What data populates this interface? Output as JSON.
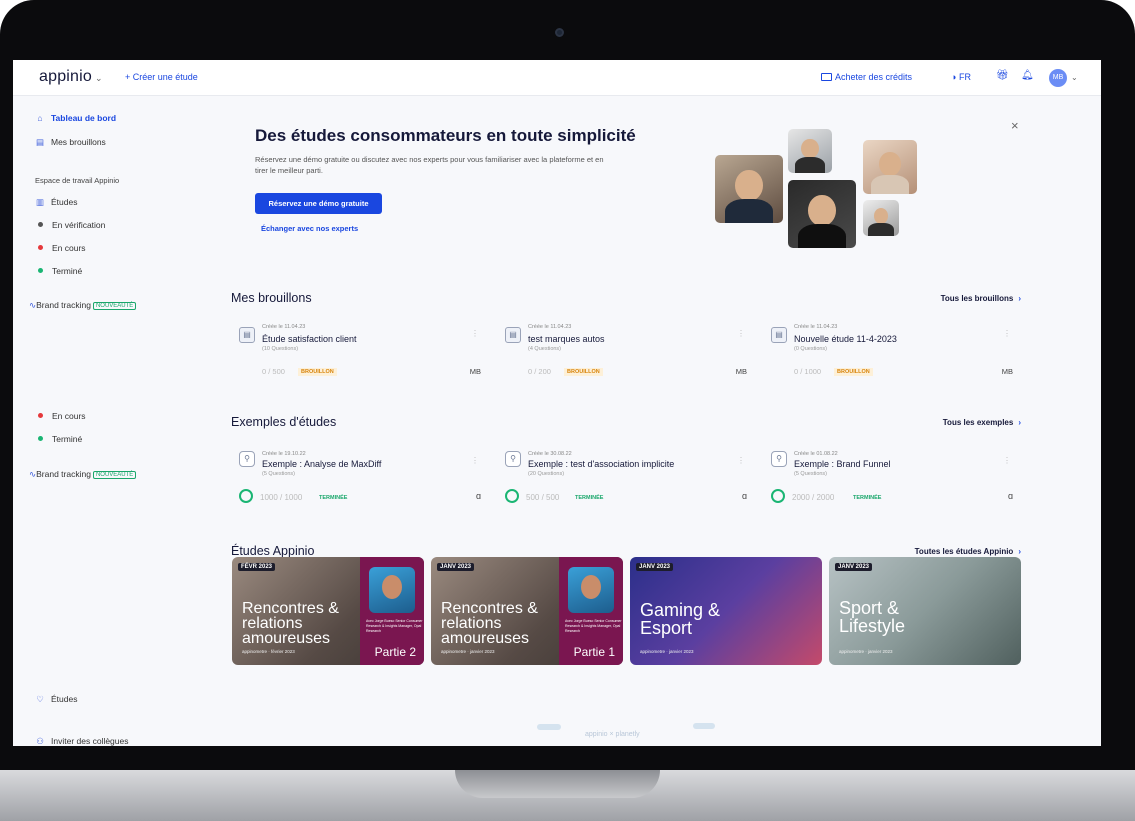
{
  "topbar": {
    "logo": "appinio",
    "create_study": "+ Créer une étude",
    "buy_credits": "Acheter des crédits",
    "language": "FR",
    "avatar": "MB"
  },
  "sidebar": {
    "dashboard": "Tableau de bord",
    "drafts": "Mes brouillons",
    "workspace": "Espace de travail Appinio",
    "studies": "Études",
    "in_review": "En vérification",
    "in_progress": "En cours",
    "finished": "Terminé",
    "brand_tracking": "Brand tracking",
    "new_badge": "NOUVEAUTÉ",
    "in_progress_2": "En cours",
    "finished_2": "Terminé",
    "brand_tracking_2": "Brand tracking",
    "new_badge_2": "NOUVEAUTÉ",
    "studies_bottom": "Études",
    "invite": "Inviter des collègues"
  },
  "hero": {
    "title": "Des études consommateurs en toute simplicité",
    "description": "Réservez une démo gratuite ou discutez avec nos experts pour vous familiariser avec la plateforme et en tirer le meilleur parti.",
    "cta": "Réservez une démo gratuite",
    "experts_link": "Échanger avec nos experts",
    "close": "×"
  },
  "drafts": {
    "title": "Mes brouillons",
    "see_all": "Tous les brouillons",
    "cards": [
      {
        "created": "Créée le 11.04.23",
        "name": "Étude satisfaction client",
        "questions": "(10 Questions)",
        "count": "0 / 500",
        "status": "BROUILLON",
        "owner": "MB"
      },
      {
        "created": "Créée le 11.04.23",
        "name": "test marques autos",
        "questions": "(4 Questions)",
        "count": "0 / 200",
        "status": "BROUILLON",
        "owner": "MB"
      },
      {
        "created": "Créée le 11.04.23",
        "name": "Nouvelle étude 11-4-2023",
        "questions": "(0 Questions)",
        "count": "0 / 1000",
        "status": "BROUILLON",
        "owner": "MB"
      }
    ]
  },
  "examples": {
    "title": "Exemples d'études",
    "see_all": "Tous les exemples",
    "cards": [
      {
        "created": "Créée le 19.10.22",
        "name": "Exemple : Analyse de MaxDiff",
        "questions": "(5 Questions)",
        "count": "1000 / 1000",
        "status": "TERMINÉE"
      },
      {
        "created": "Créée le 30.08.22",
        "name": "Exemple : test d'association implicite",
        "questions": "(20 Questions)",
        "count": "500 / 500",
        "status": "TERMINÉE"
      },
      {
        "created": "Créée le 01.08.22",
        "name": "Exemple : Brand Funnel",
        "questions": "(5 Questions)",
        "count": "2000 / 2000",
        "status": "TERMINÉE"
      }
    ]
  },
  "appinio_studies": {
    "title": "Études Appinio",
    "see_all": "Toutes les études Appinio",
    "tiles": [
      {
        "date": "FÉVR 2023",
        "title": "Rencontres & relations amoureuses",
        "part": "Partie 2",
        "sub": "appinometre · février 2023",
        "presenter": "Avec Jorge Bueso Senior Consumer Research & Insights Manager, Opal Research"
      },
      {
        "date": "JANV 2023",
        "title": "Rencontres & relations amoureuses",
        "part": "Partie 1",
        "sub": "appinometre · janvier 2023",
        "presenter": "Avec Jorge Bueso Senior Consumer Research & Insights Manager, Opal Research"
      },
      {
        "date": "JANV 2023",
        "title": "Gaming & Esport",
        "sub": "appinometre · janvier 2023"
      },
      {
        "date": "JANV 2023",
        "title": "Sport & Lifestyle",
        "sub": "appinometre · janvier 2023"
      }
    ]
  },
  "footer": {
    "brand": "appinio × planetly"
  },
  "colors": {
    "accent": "#1a47e0",
    "success": "#1ab573",
    "draft": "#d8840a",
    "in_progress_dot": "#e5383b"
  }
}
